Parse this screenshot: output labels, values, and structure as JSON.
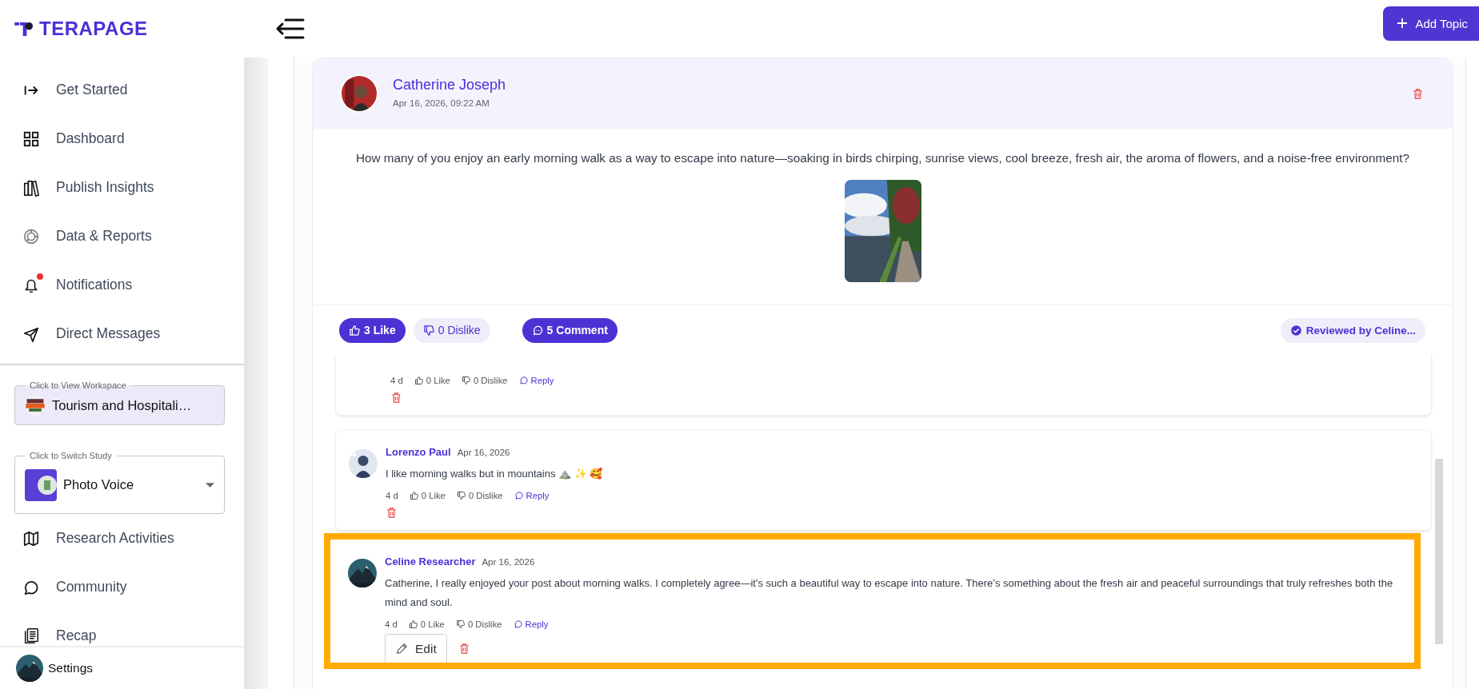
{
  "logo": {
    "text": "TERAPAGE"
  },
  "header": {
    "add_button": "Add Topic"
  },
  "sidebar": {
    "items": [
      {
        "label": "Get Started",
        "kind": "enter",
        "unread": false
      },
      {
        "label": "Dashboard",
        "kind": "grid",
        "unread": false
      },
      {
        "label": "Publish Insights",
        "kind": "books",
        "unread": false
      },
      {
        "label": "Data & Reports",
        "kind": "chart",
        "unread": false
      },
      {
        "label": "Notifications",
        "kind": "bell",
        "unread": true
      },
      {
        "label": "Direct Messages",
        "kind": "send",
        "unread": false
      }
    ],
    "workspace": {
      "label": "Click to View Workspace",
      "value": "Tourism and Hospitali…"
    },
    "study": {
      "label": "Click to Switch Study",
      "value": "Photo Voice"
    },
    "lower_items": [
      {
        "label": "Research Activities",
        "kind": "map",
        "unread": false
      },
      {
        "label": "Community",
        "kind": "chat",
        "unread": false
      },
      {
        "label": "Recap",
        "kind": "doc",
        "unread": false
      }
    ],
    "footer": {
      "label": "Settings"
    }
  },
  "post": {
    "author": "Catherine Joseph",
    "date": "Apr 16, 2026, 09:22 AM",
    "text": "How many of you enjoy an early morning walk as a way to escape into nature—soaking in birds chirping, sunrise views, cool breeze, fresh air, the aroma of flowers, and a noise-free environment?",
    "actions": [
      {
        "kind": "like",
        "label": "3 Like",
        "active": true
      },
      {
        "kind": "dislike",
        "label": "0 Dislike",
        "active": false
      },
      {
        "kind": "comment",
        "label": "5 Comment",
        "active": true
      }
    ],
    "reviewed": "Reviewed by Celine..."
  },
  "comments": [
    {
      "time": "4 d",
      "like": "0 Like",
      "dislike": "0 Dislike",
      "reply": "Reply",
      "highlighted": false
    },
    {
      "author": "Lorenzo Paul",
      "date": "Apr 16, 2026",
      "text": "I like morning walks but in mountains ⛰️  ✨  🥰",
      "time": "4 d",
      "like": "0 Like",
      "dislike": "0 Dislike",
      "reply": "Reply",
      "highlighted": false
    },
    {
      "author": "Celine Researcher",
      "date": "Apr 16, 2026",
      "text": "Catherine, I really enjoyed your post about morning walks. I completely agree—it's such a beautiful way to escape into nature. There’s something about the fresh air and peaceful surroundings that truly refreshes both the mind and soul.",
      "time": "4 d",
      "like": "0 Like",
      "dislike": "0 Dislike",
      "reply": "Reply",
      "edit": "Edit",
      "highlighted": true
    }
  ]
}
